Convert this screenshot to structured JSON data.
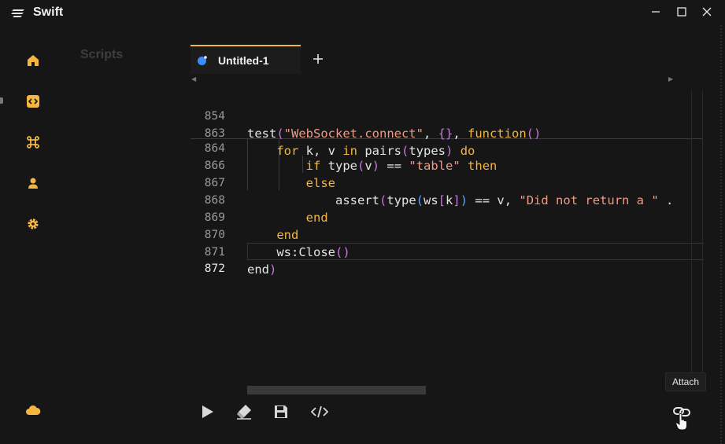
{
  "app": {
    "title": "Swift"
  },
  "sidebar": {
    "items": [
      {
        "icon": "home-icon"
      },
      {
        "icon": "code-editor-icon",
        "active": true
      },
      {
        "icon": "command-icon"
      },
      {
        "icon": "user-icon"
      },
      {
        "icon": "gear-icon"
      },
      {
        "icon": "cloud-icon"
      }
    ]
  },
  "scripts_panel": {
    "label": "Scripts"
  },
  "tabs": [
    {
      "label": "Untitled-1",
      "active": true
    }
  ],
  "editor": {
    "lines": [
      {
        "num": "854",
        "text": "test(\"WebSocket.connect\", {}, function()"
      },
      {
        "num": "863",
        "text": "    for k, v in pairs(types) do"
      },
      {
        "num": "864",
        "text": "        if type(v) == \"table\" then"
      },
      {
        "num": "866",
        "text": "        else"
      },
      {
        "num": "867",
        "text": "            assert(type(ws[k]) == v, \"Did not return a \" ."
      },
      {
        "num": "868",
        "text": "        end"
      },
      {
        "num": "869",
        "text": "    end"
      },
      {
        "num": "870",
        "text": "    ws:Close()"
      },
      {
        "num": "871",
        "text": "end)"
      },
      {
        "num": "872",
        "text": ""
      }
    ],
    "current_line": "872"
  },
  "toolbar": {
    "run_icon": "play-icon",
    "clear_icon": "eraser-icon",
    "save_icon": "floppy-icon",
    "code_icon": "code-brackets-icon",
    "attach_icon": "link-icon",
    "attach_tooltip": "Attach"
  },
  "colors": {
    "accent": "#f4b640",
    "keyword": "#f4b640",
    "string": "#ee9b85",
    "paren": "#c678dd",
    "bracket": "#58a6ff"
  }
}
